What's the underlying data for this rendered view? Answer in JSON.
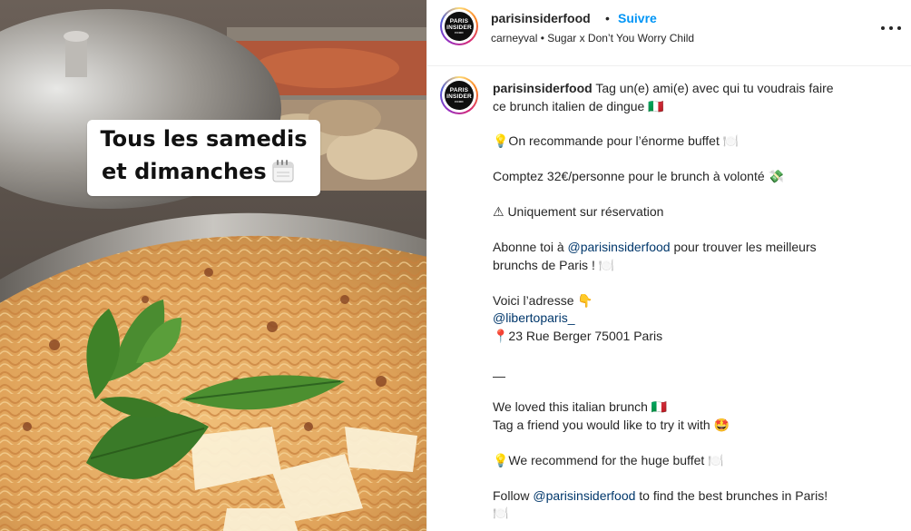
{
  "overlay": {
    "line1": "Tous les samedis",
    "line2": "et dimanches"
  },
  "header": {
    "username": "parisinsiderfood",
    "separator": "•",
    "follow_label": "Suivre",
    "subtitle": "carneyval • Sugar x Don’t You Worry Child",
    "more_label": "More options"
  },
  "avatar": {
    "line1": "PARIS",
    "line2": "INSIDER",
    "line3": "FOOD"
  },
  "caption": {
    "username": "parisinsiderfood",
    "text_line1": " Tag un(e) ami(e) avec qui tu voudrais faire",
    "text_line2": "ce brunch italien de dingue 🇮🇹",
    "p_recommend": "💡On recommande pour l’énorme buffet 🍽️",
    "p_price": "Comptez 32€/personne pour le brunch à volonté 💸",
    "p_reservation": "⚠ Uniquement sur réservation",
    "p_subscribe_prefix": "Abonne toi à ",
    "p_subscribe_mention": "@parisinsiderfood",
    "p_subscribe_suffix": " pour trouver les meilleurs",
    "p_subscribe_line2": "brunchs de Paris ! 🍽️",
    "p_address_label": "Voici l’adresse 👇",
    "p_address_mention": "@libertoparis_",
    "p_address_street": "📍23 Rue Berger 75001 Paris",
    "p_dash": "—",
    "p_en_loved": "We loved this italian brunch 🇮🇹",
    "p_en_tag": "Tag a friend you would like to try it with 🤩",
    "p_en_recommend": "💡We recommend for the huge buffet 🍽️",
    "p_en_follow_prefix": "Follow ",
    "p_en_follow_mention": "@parisinsiderfood",
    "p_en_follow_suffix": " to find the best brunches in Paris!",
    "p_en_follow_line2": "🍽️"
  },
  "colors": {
    "follow": "#0095f6",
    "mention": "#00376b",
    "text": "#262626"
  }
}
